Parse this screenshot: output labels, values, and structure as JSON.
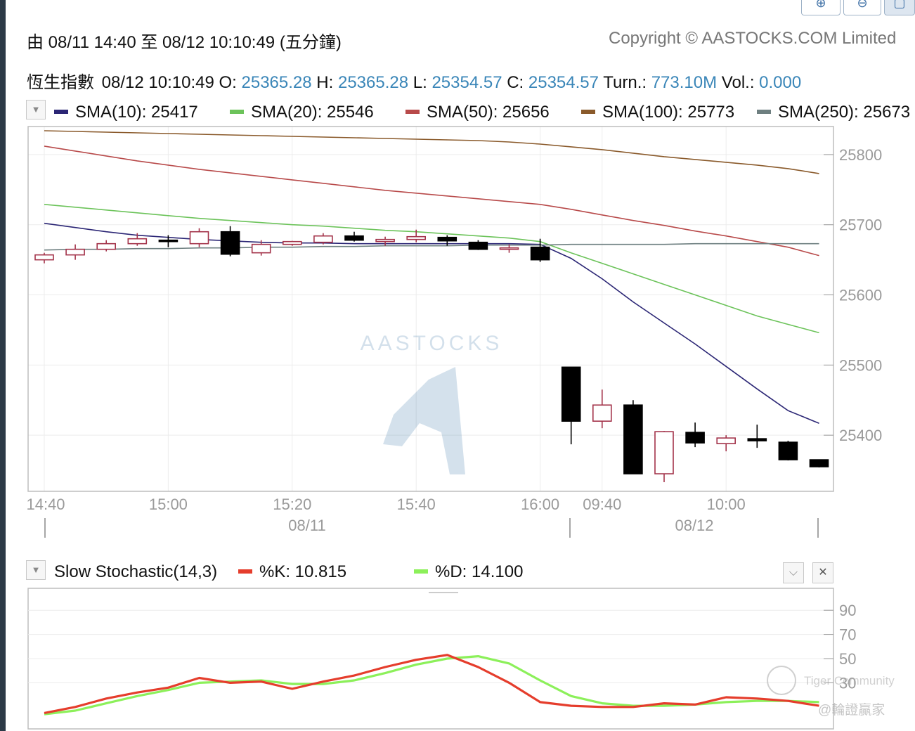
{
  "header": {
    "range_label": "由  08/11 14:40 至  08/12 10:10:49 (五分鐘)",
    "copyright": "Copyright © AASTOCKS.COM Limited"
  },
  "quote": {
    "name": "恆生指數",
    "time": "08/12 10:10:49",
    "o_label": "O:",
    "o": "25365.28",
    "h_label": "H:",
    "h": "25365.28",
    "l_label": "L:",
    "l": "25354.57",
    "c_label": "C:",
    "c": "25354.57",
    "turn_label": "Turn.:",
    "turn": "773.10M",
    "vol_label": "Vol.:",
    "vol": "0.000"
  },
  "indicators": [
    {
      "label": "SMA(10): 25417",
      "color": "#2b2675"
    },
    {
      "label": "SMA(20): 25546",
      "color": "#6cc35a"
    },
    {
      "label": "SMA(50): 25656",
      "color": "#b84a4a"
    },
    {
      "label": "SMA(100): 25773",
      "color": "#8a5a2b"
    },
    {
      "label": "SMA(250): 25673",
      "color": "#6e7f80"
    }
  ],
  "toolbar_icons": [
    "zoom-in-icon",
    "zoom-out-icon",
    "reset-icon"
  ],
  "watermark": "AASTOCKS",
  "stoch": {
    "title": "Slow Stochastic(14,3)",
    "k_label": "%K: 10.815",
    "d_label": "%D: 14.100",
    "k_color": "#e53d2c",
    "d_color": "#8cf05a"
  },
  "community": {
    "name": "Tiger Community",
    "user": "@輪證贏家"
  },
  "chart_data": [
    {
      "type": "candlestick",
      "candle_up_color": "#a3334a",
      "candle_down_color": "#000000",
      "ylim": [
        25320,
        25840
      ],
      "yticks": [
        25400,
        25500,
        25600,
        25700,
        25800
      ],
      "time_ticks": [
        "14:40",
        "15:00",
        "15:20",
        "15:40",
        "16:00",
        "09:40",
        "10:00"
      ],
      "date_labels": [
        "08/11",
        "08/12"
      ],
      "ohlc": [
        {
          "o": 25650,
          "h": 25660,
          "l": 25645,
          "c": 25657
        },
        {
          "o": 25657,
          "h": 25672,
          "l": 25650,
          "c": 25665
        },
        {
          "o": 25665,
          "h": 25678,
          "l": 25662,
          "c": 25673
        },
        {
          "o": 25673,
          "h": 25688,
          "l": 25670,
          "c": 25680
        },
        {
          "o": 25678,
          "h": 25685,
          "l": 25668,
          "c": 25676
        },
        {
          "o": 25673,
          "h": 25695,
          "l": 25668,
          "c": 25690
        },
        {
          "o": 25690,
          "h": 25698,
          "l": 25655,
          "c": 25658
        },
        {
          "o": 25660,
          "h": 25678,
          "l": 25656,
          "c": 25672
        },
        {
          "o": 25672,
          "h": 25677,
          "l": 25670,
          "c": 25676
        },
        {
          "o": 25675,
          "h": 25688,
          "l": 25672,
          "c": 25684
        },
        {
          "o": 25684,
          "h": 25690,
          "l": 25676,
          "c": 25678
        },
        {
          "o": 25676,
          "h": 25683,
          "l": 25670,
          "c": 25679
        },
        {
          "o": 25679,
          "h": 25693,
          "l": 25675,
          "c": 25683
        },
        {
          "o": 25682,
          "h": 25685,
          "l": 25670,
          "c": 25677
        },
        {
          "o": 25675,
          "h": 25678,
          "l": 25664,
          "c": 25665
        },
        {
          "o": 25667,
          "h": 25672,
          "l": 25660,
          "c": 25667
        },
        {
          "o": 25668,
          "h": 25680,
          "l": 25647,
          "c": 25650
        },
        {
          "o": 25497,
          "h": 25497,
          "l": 25387,
          "c": 25420
        },
        {
          "o": 25420,
          "h": 25465,
          "l": 25410,
          "c": 25443
        },
        {
          "o": 25443,
          "h": 25450,
          "l": 25345,
          "c": 25345
        },
        {
          "o": 25345,
          "h": 25406,
          "l": 25333,
          "c": 25405
        },
        {
          "o": 25404,
          "h": 25418,
          "l": 25383,
          "c": 25389
        },
        {
          "o": 25388,
          "h": 25400,
          "l": 25377,
          "c": 25396
        },
        {
          "o": 25395,
          "h": 25415,
          "l": 25382,
          "c": 25392
        },
        {
          "o": 25390,
          "h": 25392,
          "l": 25364,
          "c": 25365
        },
        {
          "o": 25365,
          "h": 25365,
          "l": 25354,
          "c": 25355
        }
      ],
      "series": [
        {
          "name": "SMA(10)",
          "color": "#2b2675",
          "values": [
            25702,
            25696,
            25690,
            25685,
            25682,
            25679,
            25677,
            25675,
            25674,
            25674,
            25673,
            25673,
            25673,
            25673,
            25673,
            25673,
            25672,
            25652,
            25623,
            25590,
            25560,
            25530,
            25498,
            25466,
            25435,
            25417
          ]
        },
        {
          "name": "SMA(20)",
          "color": "#6cc35a",
          "values": [
            25729,
            25725,
            25721,
            25717,
            25713,
            25709,
            25706,
            25703,
            25700,
            25698,
            25695,
            25692,
            25690,
            25687,
            25684,
            25681,
            25676,
            25660,
            25645,
            25630,
            25615,
            25600,
            25585,
            25570,
            25558,
            25546
          ]
        },
        {
          "name": "SMA(50)",
          "color": "#b84a4a",
          "values": [
            25812,
            25805,
            25798,
            25791,
            25785,
            25779,
            25774,
            25769,
            25764,
            25759,
            25754,
            25749,
            25745,
            25741,
            25737,
            25733,
            25729,
            25722,
            25714,
            25706,
            25699,
            25691,
            25684,
            25676,
            25668,
            25656
          ]
        },
        {
          "name": "SMA(100)",
          "color": "#8a5a2b",
          "values": [
            25834,
            25833,
            25832,
            25831,
            25830,
            25829,
            25828,
            25827,
            25826,
            25825,
            25824,
            25823,
            25822,
            25821,
            25820,
            25818,
            25815,
            25811,
            25807,
            25802,
            25797,
            25793,
            25789,
            25785,
            25780,
            25773
          ]
        },
        {
          "name": "SMA(250)",
          "color": "#6e7f80",
          "values": [
            25664,
            25665,
            25665,
            25666,
            25666,
            25667,
            25667,
            25668,
            25668,
            25669,
            25669,
            25670,
            25670,
            25670,
            25671,
            25671,
            25671,
            25672,
            25672,
            25672,
            25672,
            25673,
            25673,
            25673,
            25673,
            25673
          ]
        }
      ]
    },
    {
      "type": "line",
      "ylim": [
        0,
        100
      ],
      "yticks": [
        30,
        50,
        70,
        90
      ],
      "series": [
        {
          "name": "%K",
          "color": "#e53d2c",
          "values": [
            5,
            10,
            17,
            22,
            26,
            34,
            30,
            31,
            25,
            31,
            36,
            43,
            49,
            53,
            43,
            30,
            14,
            11,
            10,
            10,
            13,
            12,
            18,
            17,
            15,
            11
          ]
        },
        {
          "name": "%D",
          "color": "#8cf05a",
          "values": [
            4,
            7,
            13,
            19,
            24,
            30,
            31,
            32,
            29,
            29,
            32,
            38,
            45,
            50,
            52,
            46,
            32,
            19,
            13,
            11,
            11,
            12,
            14,
            15,
            15,
            14
          ]
        }
      ]
    }
  ]
}
